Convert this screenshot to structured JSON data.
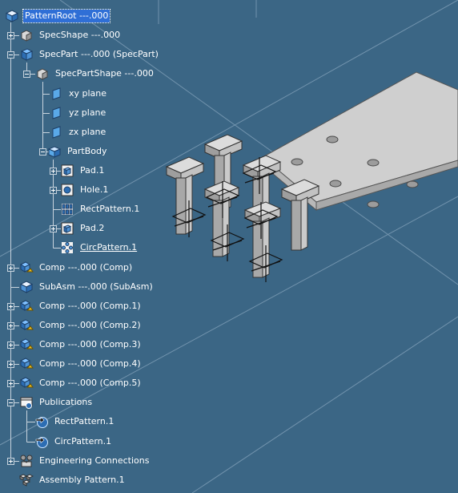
{
  "tree": {
    "root": {
      "label": "PatternRoot ---.000",
      "icon": "product-icon",
      "selected": true
    },
    "spec_shape": {
      "label": "SpecShape ---.000",
      "icon": "shape-icon"
    },
    "spec_part": {
      "label": "SpecPart ---.000 (SpecPart)",
      "icon": "part-icon"
    },
    "spec_part_shape": {
      "label": "SpecPartShape ---.000",
      "icon": "shape-icon"
    },
    "xy_plane": {
      "label": "xy plane",
      "icon": "plane-icon"
    },
    "yz_plane": {
      "label": "yz plane",
      "icon": "plane-icon"
    },
    "zx_plane": {
      "label": "zx plane",
      "icon": "plane-icon"
    },
    "part_body": {
      "label": "PartBody",
      "icon": "body-icon"
    },
    "pad1": {
      "label": "Pad.1",
      "icon": "pad-icon"
    },
    "hole1": {
      "label": "Hole.1",
      "icon": "hole-icon"
    },
    "rect_pattern1": {
      "label": "RectPattern.1",
      "icon": "rect-pattern-icon"
    },
    "pad2": {
      "label": "Pad.2",
      "icon": "pad-icon"
    },
    "circ_pattern1": {
      "label": "CircPattern.1",
      "icon": "circ-pattern-icon"
    },
    "comp": {
      "label": "Comp ---.000 (Comp)",
      "icon": "component-icon"
    },
    "subasm": {
      "label": "SubAsm ---.000 (SubAsm)",
      "icon": "product-icon"
    },
    "comp1": {
      "label": "Comp ---.000 (Comp.1)",
      "icon": "component-icon"
    },
    "comp2": {
      "label": "Comp ---.000 (Comp.2)",
      "icon": "component-icon"
    },
    "comp3": {
      "label": "Comp ---.000 (Comp.3)",
      "icon": "component-icon"
    },
    "comp4": {
      "label": "Comp ---.000 (Comp.4)",
      "icon": "component-icon"
    },
    "comp5": {
      "label": "Comp ---.000 (Comp.5)",
      "icon": "component-icon"
    },
    "publications": {
      "label": "Publications",
      "icon": "publications-icon"
    },
    "pub_rect": {
      "label": "RectPattern.1",
      "icon": "publication-icon"
    },
    "pub_circ": {
      "label": "CircPattern.1",
      "icon": "publication-icon"
    },
    "eng_connections": {
      "label": "Engineering Connections",
      "icon": "engineering-connections-icon"
    },
    "assembly_pattern": {
      "label": "Assembly Pattern.1",
      "icon": "assembly-pattern-icon"
    }
  },
  "colors": {
    "background": "#3b6685",
    "selection": "#2f6fd6",
    "tree_line": "#c8d4de",
    "part_face_top": "#e2e2e2",
    "part_face_side": "#b4b4b4"
  }
}
